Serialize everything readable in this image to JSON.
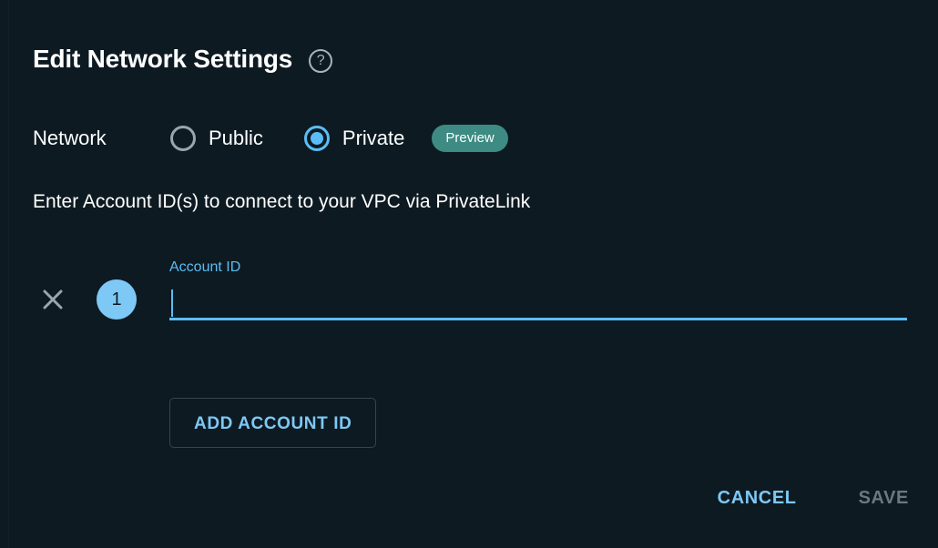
{
  "dialog": {
    "title": "Edit Network Settings",
    "help_icon": "help-circle-icon"
  },
  "network": {
    "label": "Network",
    "options": [
      {
        "label": "Public",
        "selected": false
      },
      {
        "label": "Private",
        "selected": true
      }
    ],
    "badge": "Preview"
  },
  "instruction": "Enter Account ID(s) to connect to your VPC via PrivateLink",
  "account_rows": [
    {
      "index": "1",
      "field_label": "Account ID",
      "value": "",
      "placeholder": "",
      "remove_icon": "close-x-icon"
    }
  ],
  "add_button": "ADD ACCOUNT ID",
  "footer": {
    "cancel": "CANCEL",
    "save": "SAVE"
  },
  "colors": {
    "background": "#0d1a22",
    "accent_blue": "#5bbdf5",
    "badge_teal": "#3d8b83",
    "number_badge": "#7ec8f5",
    "disabled_text": "#6b7880",
    "muted_icon": "#9aa5ad"
  }
}
